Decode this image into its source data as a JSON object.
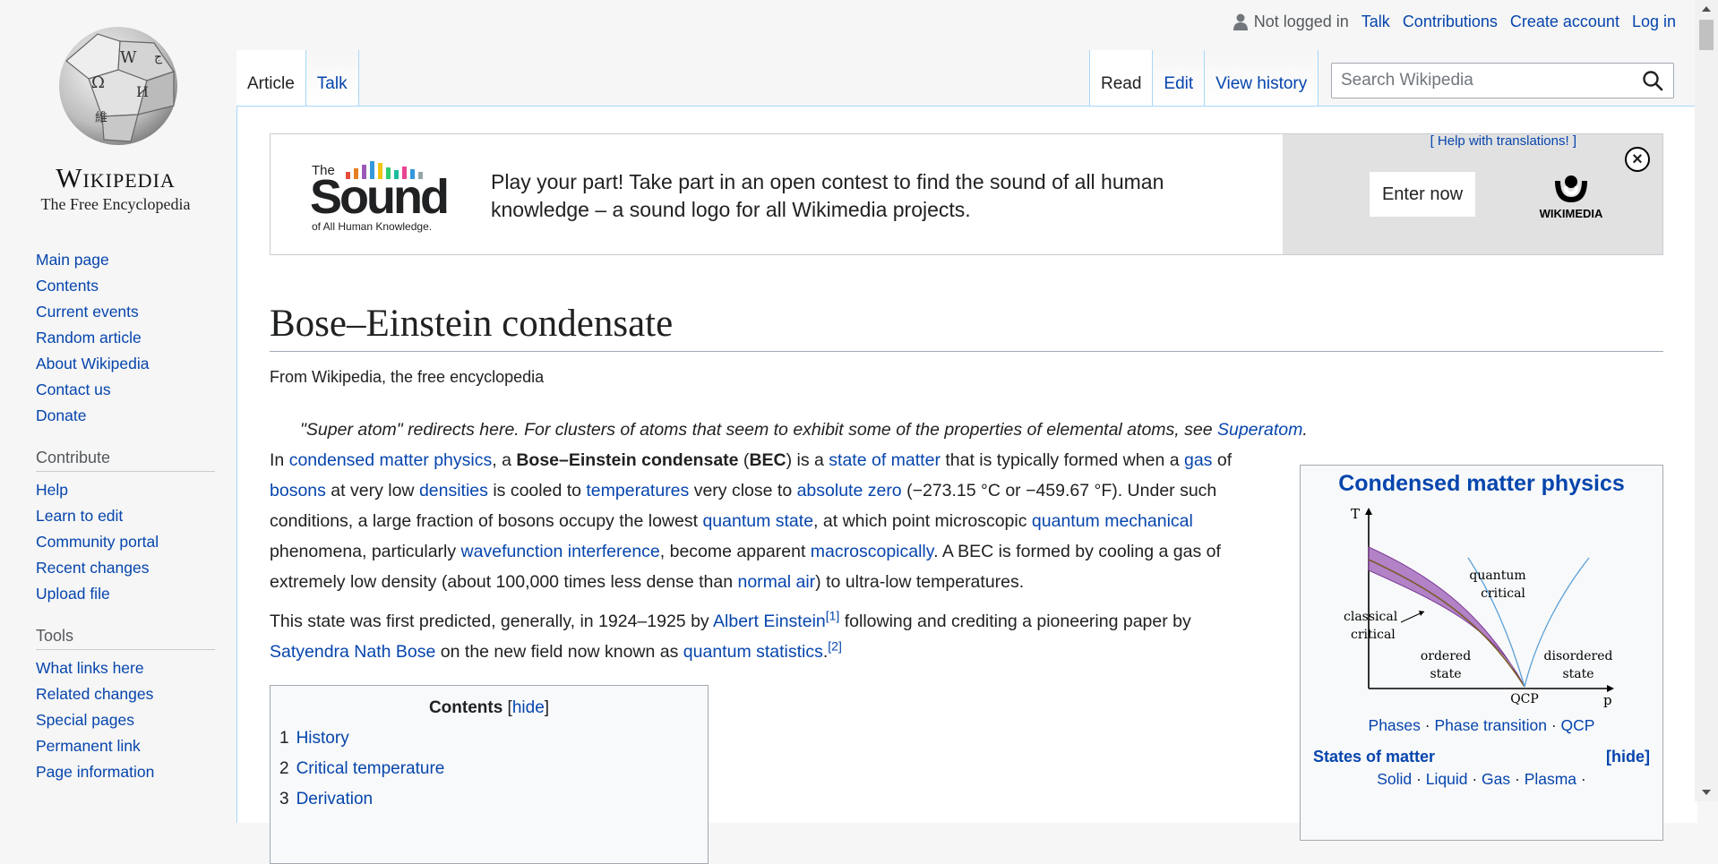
{
  "personal": {
    "status": "Not logged in",
    "links": [
      "Talk",
      "Contributions",
      "Create account",
      "Log in"
    ]
  },
  "logo": {
    "wordmark": "Wikipedia",
    "tagline": "The Free Encyclopedia"
  },
  "sidebar": {
    "navigation": [
      "Main page",
      "Contents",
      "Current events",
      "Random article",
      "About Wikipedia",
      "Contact us",
      "Donate"
    ],
    "contribute_heading": "Contribute",
    "contribute": [
      "Help",
      "Learn to edit",
      "Community portal",
      "Recent changes",
      "Upload file"
    ],
    "tools_heading": "Tools",
    "tools": [
      "What links here",
      "Related changes",
      "Special pages",
      "Permanent link",
      "Page information"
    ]
  },
  "tabs": {
    "left": [
      "Article",
      "Talk"
    ],
    "right": [
      "Read",
      "Edit",
      "View history"
    ]
  },
  "search": {
    "placeholder": "Search Wikipedia"
  },
  "banner": {
    "logo_top": "The",
    "logo_main": "Sound",
    "logo_sub": "of All Human Knowledge.",
    "message": "Play your part! Take part in an open contest to find the sound of all human knowledge – a sound logo for all Wikimedia projects.",
    "help": "[ Help with translations! ]",
    "button": "Enter now",
    "brand": "WIKIMEDIA",
    "close": "×"
  },
  "article": {
    "title": "Bose–Einstein condensate",
    "site_sub": "From Wikipedia, the free encyclopedia",
    "hatnote_text": "\"Super atom\" redirects here. For clusters of atoms that seem to exhibit some of the properties of elemental atoms, see ",
    "hatnote_link": "Superatom",
    "hatnote_end": "."
  },
  "toc": {
    "title": "Contents",
    "hide": "hide",
    "items": [
      {
        "num": "1",
        "label": "History"
      },
      {
        "num": "2",
        "label": "Critical temperature"
      },
      {
        "num": "3",
        "label": "Derivation"
      }
    ]
  },
  "infobox": {
    "title": "Condensed matter physics",
    "diagram": {
      "y_axis": "T",
      "x_axis": "p",
      "labels": [
        "quantum critical",
        "classical critical",
        "ordered state",
        "disordered state",
        "QCP"
      ]
    },
    "links": [
      "Phases",
      "Phase transition",
      "QCP"
    ],
    "section": "States of matter",
    "hide": "[hide]",
    "sub_links": [
      "Solid",
      "Liquid",
      "Gas",
      "Plasma"
    ]
  },
  "colors": {
    "link": "#0645ad",
    "tab_border": "#a7d7f9",
    "banner_grey": "#e1e1e1",
    "phase_band": "#9b59b6"
  }
}
